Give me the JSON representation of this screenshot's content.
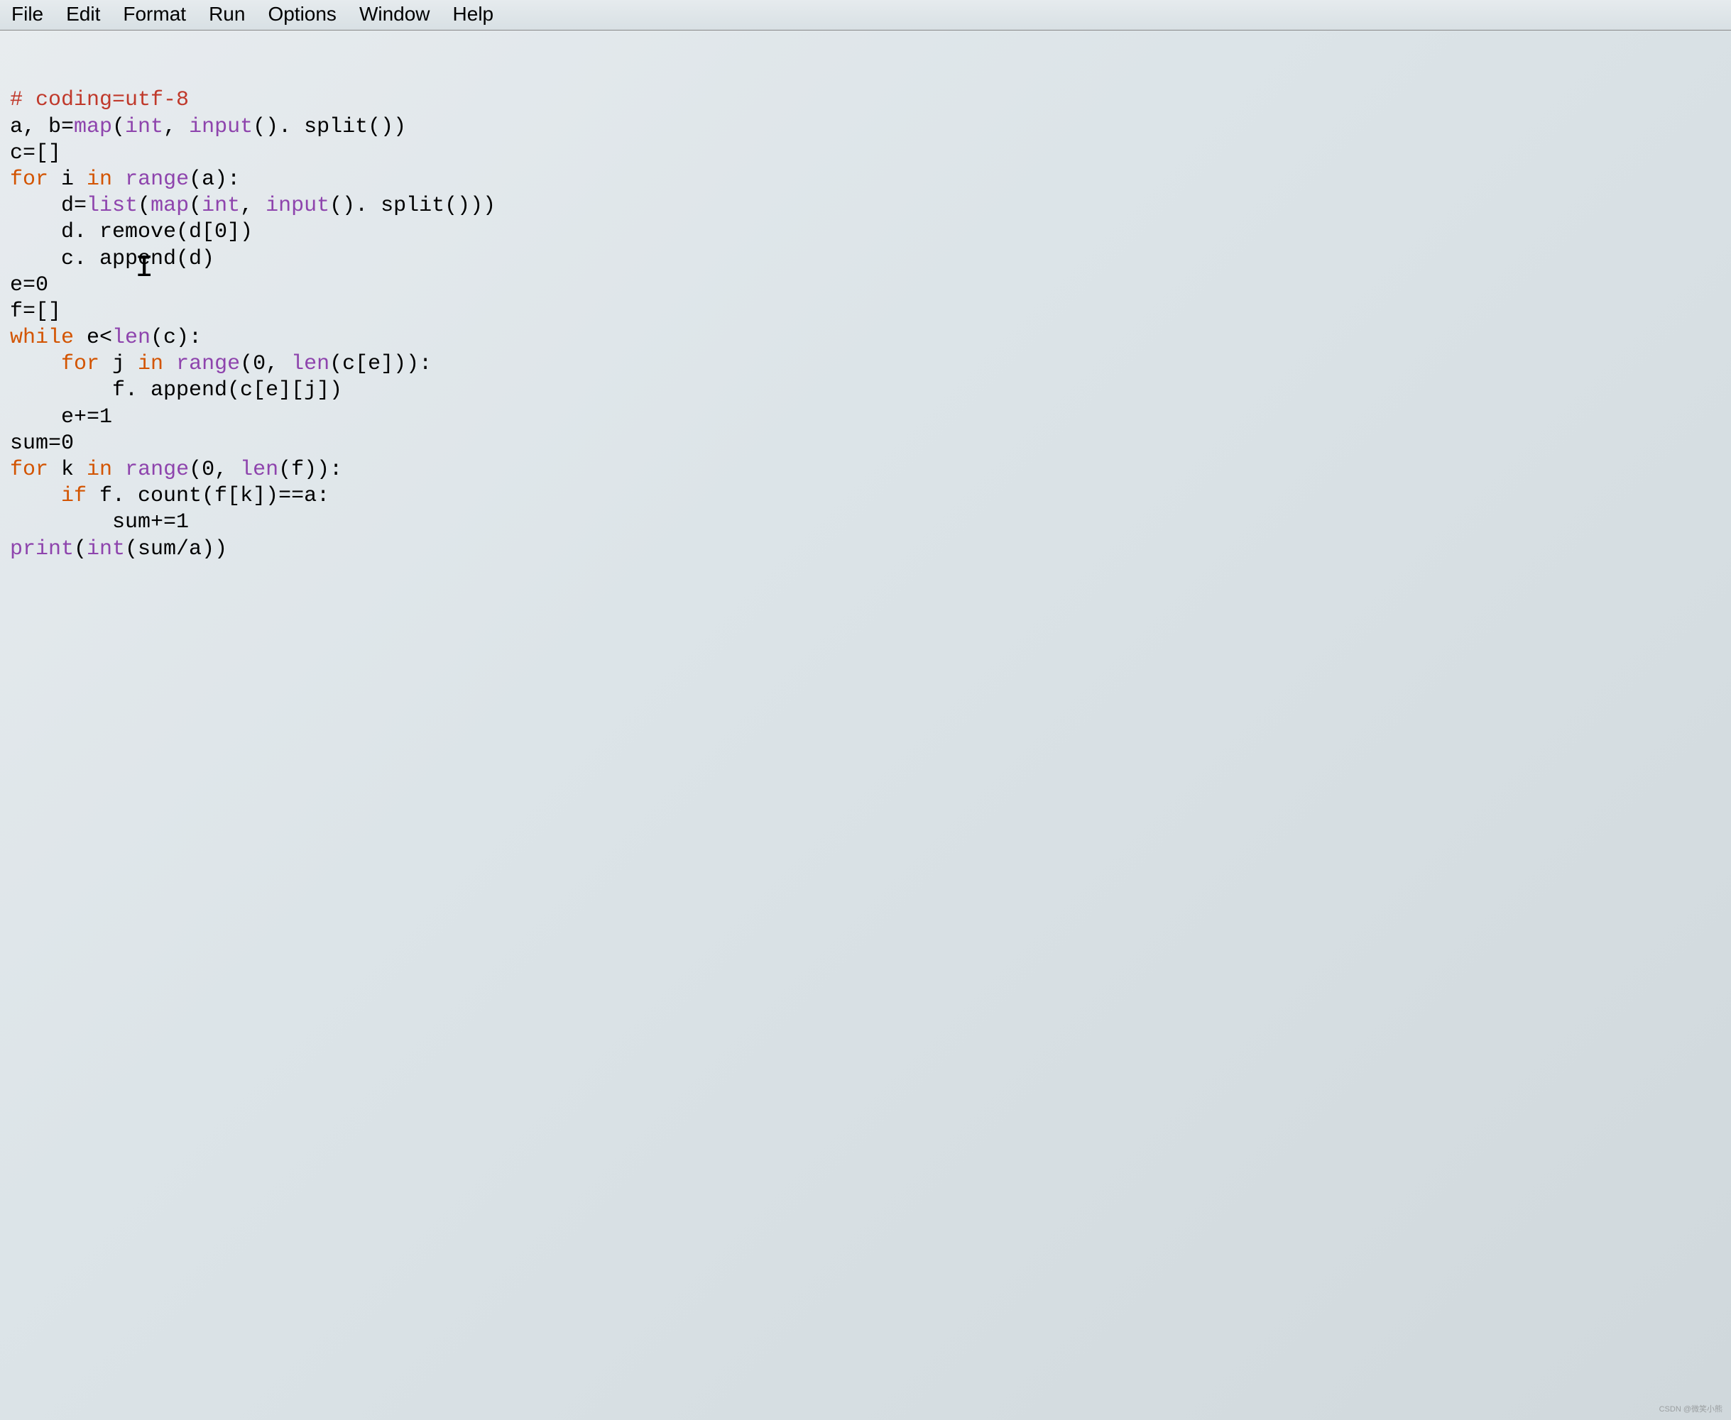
{
  "menu": {
    "items": [
      "File",
      "Edit",
      "Format",
      "Run",
      "Options",
      "Window",
      "Help"
    ]
  },
  "code": {
    "lines": [
      {
        "indent": 0,
        "tokens": [
          {
            "t": "comment",
            "v": "# coding=utf-8"
          }
        ]
      },
      {
        "indent": 0,
        "tokens": [
          {
            "t": "plain",
            "v": "a, b="
          },
          {
            "t": "builtin",
            "v": "map"
          },
          {
            "t": "plain",
            "v": "("
          },
          {
            "t": "builtin",
            "v": "int"
          },
          {
            "t": "plain",
            "v": ", "
          },
          {
            "t": "builtin",
            "v": "input"
          },
          {
            "t": "plain",
            "v": "(). split())"
          }
        ]
      },
      {
        "indent": 0,
        "tokens": [
          {
            "t": "plain",
            "v": "c=[]"
          }
        ]
      },
      {
        "indent": 0,
        "tokens": [
          {
            "t": "keyword",
            "v": "for"
          },
          {
            "t": "plain",
            "v": " i "
          },
          {
            "t": "keyword",
            "v": "in"
          },
          {
            "t": "plain",
            "v": " "
          },
          {
            "t": "builtin",
            "v": "range"
          },
          {
            "t": "plain",
            "v": "(a):"
          }
        ]
      },
      {
        "indent": 1,
        "tokens": [
          {
            "t": "plain",
            "v": "d="
          },
          {
            "t": "builtin",
            "v": "list"
          },
          {
            "t": "plain",
            "v": "("
          },
          {
            "t": "builtin",
            "v": "map"
          },
          {
            "t": "plain",
            "v": "("
          },
          {
            "t": "builtin",
            "v": "int"
          },
          {
            "t": "plain",
            "v": ", "
          },
          {
            "t": "builtin",
            "v": "input"
          },
          {
            "t": "plain",
            "v": "(). split()))"
          }
        ]
      },
      {
        "indent": 1,
        "tokens": [
          {
            "t": "plain",
            "v": "d. remove(d[0])"
          }
        ]
      },
      {
        "indent": 1,
        "tokens": [
          {
            "t": "plain",
            "v": "c. append(d)"
          }
        ]
      },
      {
        "indent": 0,
        "tokens": [
          {
            "t": "plain",
            "v": "e=0"
          }
        ]
      },
      {
        "indent": 0,
        "tokens": [
          {
            "t": "plain",
            "v": "f=[]"
          }
        ]
      },
      {
        "indent": 0,
        "tokens": [
          {
            "t": "keyword",
            "v": "while"
          },
          {
            "t": "plain",
            "v": " e<"
          },
          {
            "t": "builtin",
            "v": "len"
          },
          {
            "t": "plain",
            "v": "(c):"
          }
        ]
      },
      {
        "indent": 1,
        "tokens": [
          {
            "t": "keyword",
            "v": "for"
          },
          {
            "t": "plain",
            "v": " j "
          },
          {
            "t": "keyword",
            "v": "in"
          },
          {
            "t": "plain",
            "v": " "
          },
          {
            "t": "builtin",
            "v": "range"
          },
          {
            "t": "plain",
            "v": "(0, "
          },
          {
            "t": "builtin",
            "v": "len"
          },
          {
            "t": "plain",
            "v": "(c[e])):"
          }
        ]
      },
      {
        "indent": 2,
        "tokens": [
          {
            "t": "plain",
            "v": "f. append(c[e][j])"
          }
        ]
      },
      {
        "indent": 1,
        "tokens": [
          {
            "t": "plain",
            "v": "e+=1"
          }
        ]
      },
      {
        "indent": 0,
        "tokens": [
          {
            "t": "plain",
            "v": "sum=0"
          }
        ]
      },
      {
        "indent": 0,
        "tokens": [
          {
            "t": "keyword",
            "v": "for"
          },
          {
            "t": "plain",
            "v": " k "
          },
          {
            "t": "keyword",
            "v": "in"
          },
          {
            "t": "plain",
            "v": " "
          },
          {
            "t": "builtin",
            "v": "range"
          },
          {
            "t": "plain",
            "v": "(0, "
          },
          {
            "t": "builtin",
            "v": "len"
          },
          {
            "t": "plain",
            "v": "(f)):"
          }
        ]
      },
      {
        "indent": 1,
        "tokens": [
          {
            "t": "keyword",
            "v": "if"
          },
          {
            "t": "plain",
            "v": " f. count(f[k])==a:"
          }
        ]
      },
      {
        "indent": 2,
        "tokens": [
          {
            "t": "plain",
            "v": "sum+=1"
          }
        ]
      },
      {
        "indent": 0,
        "tokens": [
          {
            "t": "builtin",
            "v": "print"
          },
          {
            "t": "plain",
            "v": "("
          },
          {
            "t": "builtin",
            "v": "int"
          },
          {
            "t": "plain",
            "v": "(sum/a))"
          }
        ]
      }
    ],
    "indent_string": "    "
  },
  "watermark": "CSDN @微笑小熊"
}
